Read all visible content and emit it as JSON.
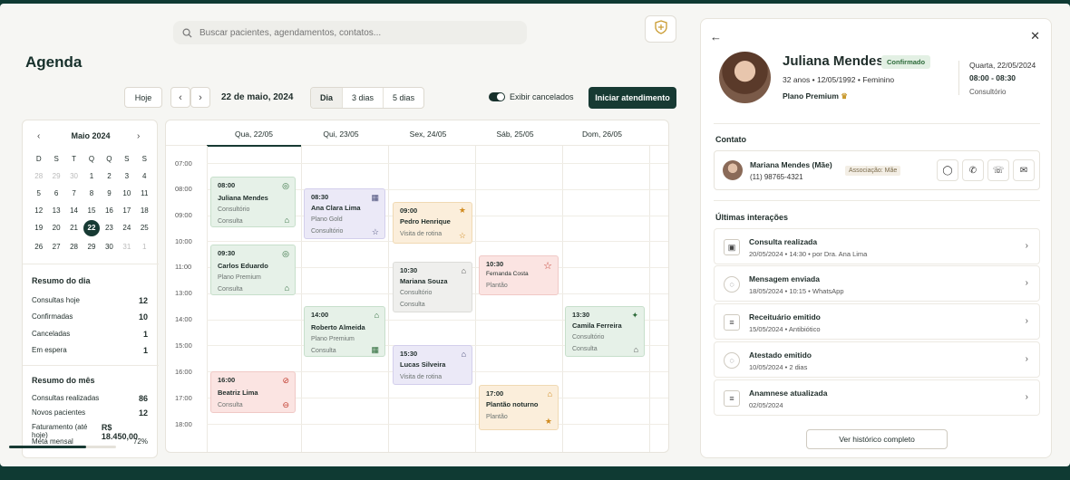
{
  "search": {
    "placeholder": "Buscar pacientes, agendamentos, contatos..."
  },
  "page": {
    "title": "Agenda"
  },
  "toolbar": {
    "today": "Hoje",
    "date": "22 de maio, 2024",
    "views": [
      "Dia",
      "3 dias",
      "5 dias"
    ],
    "show_cancelled": "Exibir cancelados",
    "start": "Iniciar atendimento"
  },
  "mini_cal": {
    "month": "Maio 2024",
    "weekdays": [
      "D",
      "S",
      "T",
      "Q",
      "Q",
      "S",
      "S"
    ],
    "days": [
      [
        "28",
        "29",
        "30",
        "1",
        "2",
        "3",
        "4"
      ],
      [
        "5",
        "6",
        "7",
        "8",
        "9",
        "10",
        "11"
      ],
      [
        "12",
        "13",
        "14",
        "15",
        "16",
        "17",
        "18"
      ],
      [
        "19",
        "20",
        "21",
        "22",
        "23",
        "24",
        "25"
      ],
      [
        "26",
        "27",
        "28",
        "29",
        "30",
        "31",
        "1"
      ]
    ]
  },
  "summary_day": {
    "title": "Resumo do dia",
    "rows": [
      {
        "label": "Consultas hoje",
        "value": "12"
      },
      {
        "label": "Confirmadas",
        "value": "10"
      },
      {
        "label": "Canceladas",
        "value": "1"
      },
      {
        "label": "Em espera",
        "value": "1"
      }
    ]
  },
  "summary_month": {
    "title": "Resumo do mês",
    "rows": [
      {
        "label": "Consultas realizadas",
        "value": "86"
      },
      {
        "label": "Novos pacientes",
        "value": "12"
      },
      {
        "label": "Faturamento (até hoje)",
        "value": "R$ 18.450,00"
      },
      {
        "label": "Meta mensal",
        "value": "72%"
      }
    ],
    "goal_progress": 0.72
  },
  "calendar": {
    "days": [
      "Qua, 22/05",
      "Qui, 23/05",
      "Sex, 24/05",
      "Sáb, 25/05",
      "Dom, 26/05"
    ],
    "times": [
      "07:00",
      "08:00",
      "09:00",
      "10:00",
      "11:00",
      "13:00",
      "14:00",
      "15:00",
      "16:00",
      "17:00",
      "18:00"
    ],
    "appointments": [
      {
        "time": "08:00",
        "name": "Juliana Mendes",
        "sub": "Consultório",
        "type": "Consulta"
      },
      {
        "time": "09:30",
        "name": "Carlos Eduardo",
        "sub": "Plano Premium",
        "type": "Consulta"
      },
      {
        "time": "16:00",
        "name": "Beatriz Lima",
        "type": "Consulta"
      },
      {
        "time": "08:30",
        "name": "Ana Clara Lima",
        "sub": "Plano Gold",
        "type": "Consultório"
      },
      {
        "time": "14:00",
        "name": "Roberto Almeida",
        "sub": "Plano Premium",
        "type": "Consulta"
      },
      {
        "time": "09:00",
        "name": "Pedro Henrique",
        "type": "Visita de rotina"
      },
      {
        "time": "10:30",
        "name": "Mariana Souza",
        "sub": "Consultório",
        "type": "Consulta"
      },
      {
        "time": "15:30",
        "name": "Lucas Silveira",
        "type": "Visita de rotina"
      },
      {
        "time": "10:30",
        "name": "Fernanda Costa",
        "type": "Plantão"
      },
      {
        "time": "17:00",
        "name": "Plantão noturno",
        "type": "Plantão"
      },
      {
        "time": "13:30",
        "name": "Camila Ferreira",
        "sub": "Consultório",
        "type": "Consulta"
      }
    ]
  },
  "patient": {
    "name": "Juliana Mendes",
    "status": "Confirmado",
    "meta": "32 anos  •  12/05/1992  •  Feminino",
    "plan": "Plano Premium",
    "date": "Quarta, 22/05/2024",
    "time": "08:00 - 08:30",
    "location": "Consultório"
  },
  "contact": {
    "title": "Contato",
    "name": "Mariana Mendes (Mãe)",
    "phone": "(11) 98765-4321",
    "association": "Associação: Mãe"
  },
  "interactions": {
    "title": "Últimas interações",
    "items": [
      {
        "title": "Consulta realizada",
        "sub": "20/05/2024  •  14:30  •  por Dra. Ana Lima"
      },
      {
        "title": "Mensagem enviada",
        "sub": "18/05/2024  •  10:15  •  WhatsApp"
      },
      {
        "title": "Receituário emitido",
        "sub": "15/05/2024  •  Antibiótico"
      },
      {
        "title": "Atestado emitido",
        "sub": "10/05/2024  •  2 dias"
      },
      {
        "title": "Anamnese atualizada",
        "sub": "02/05/2024"
      }
    ],
    "history_button": "Ver histórico completo"
  },
  "colors": {
    "primary": "#173a33",
    "confirmed": "#2d6b3a"
  }
}
